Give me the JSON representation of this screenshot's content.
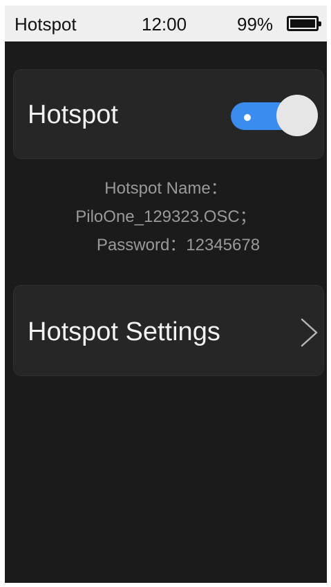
{
  "status_bar": {
    "title": "Hotspot",
    "time": "12:00",
    "battery": "99%",
    "battery_icon": "battery-icon",
    "battery_level": 0.99
  },
  "hotspot_card": {
    "label": "Hotspot",
    "toggle_on": true,
    "toggle_color": "#3a8dee"
  },
  "info": {
    "name_line": "Hotspot Name：",
    "ssid_line": "PiloOne_129323.OSC；",
    "password_line": "Password：12345678"
  },
  "settings_card": {
    "label": "Hotspot Settings",
    "icon": "chevron-right-icon"
  }
}
